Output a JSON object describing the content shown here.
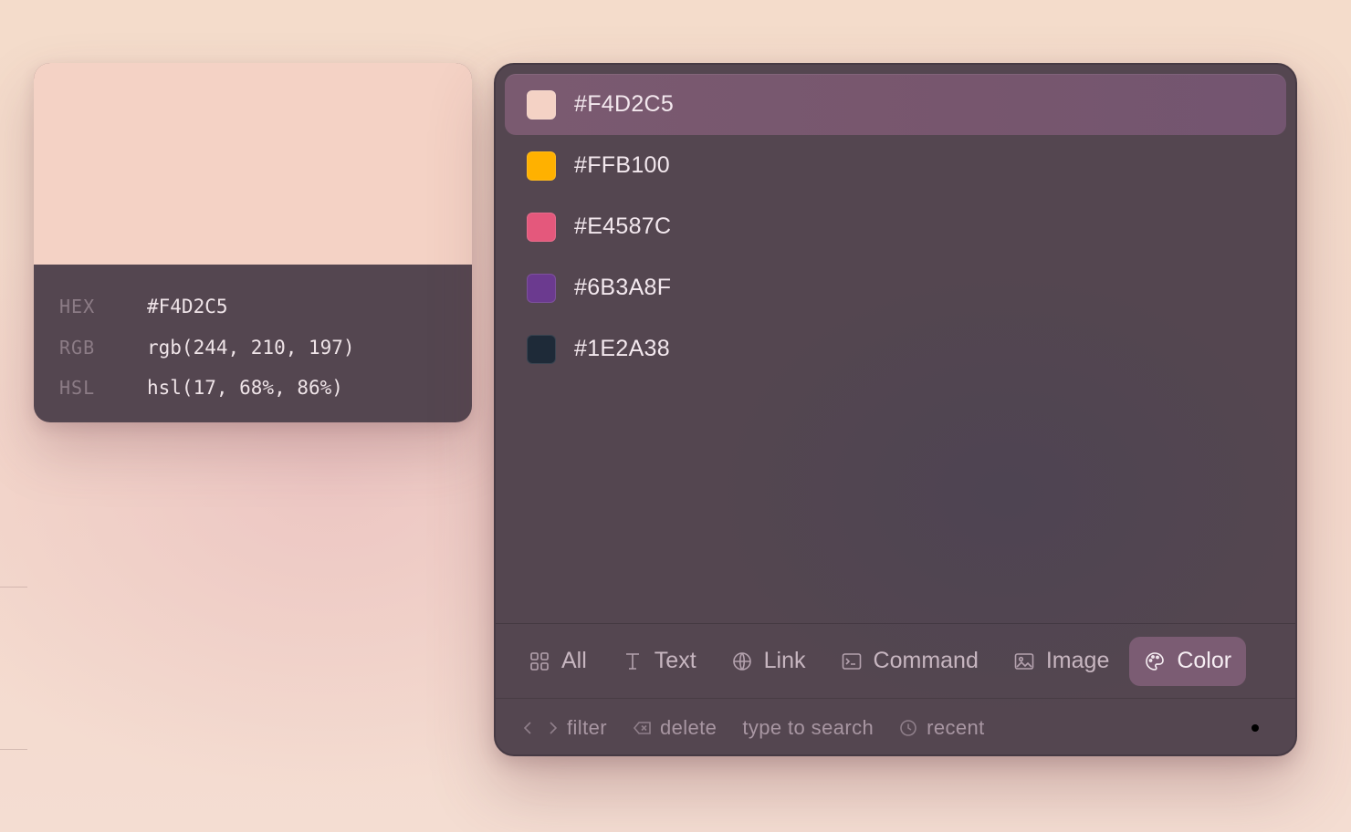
{
  "preview": {
    "swatch_color": "#F4D2C5",
    "rows": [
      {
        "key": "HEX",
        "value": "#F4D2C5"
      },
      {
        "key": "RGB",
        "value": "rgb(244, 210, 197)"
      },
      {
        "key": "HSL",
        "value": "hsl(17, 68%, 86%)"
      }
    ]
  },
  "colors": [
    {
      "label": "#F4D2C5",
      "swatch": "#F4D2C5",
      "selected": true
    },
    {
      "label": "#FFB100",
      "swatch": "#FFB100",
      "selected": false
    },
    {
      "label": "#E4587C",
      "swatch": "#E4587C",
      "selected": false
    },
    {
      "label": "#6B3A8F",
      "swatch": "#6B3A8F",
      "selected": false
    },
    {
      "label": "#1E2A38",
      "swatch": "#1E2A38",
      "selected": false
    }
  ],
  "tabs": [
    {
      "label": "All",
      "icon": "grid-icon",
      "active": false
    },
    {
      "label": "Text",
      "icon": "text-cursor-icon",
      "active": false
    },
    {
      "label": "Link",
      "icon": "globe-icon",
      "active": false
    },
    {
      "label": "Command",
      "icon": "terminal-icon",
      "active": false
    },
    {
      "label": "Image",
      "icon": "image-icon",
      "active": false
    },
    {
      "label": "Color",
      "icon": "palette-icon",
      "active": true
    }
  ],
  "hints": {
    "filter": "filter",
    "delete": "delete",
    "search": "type to search",
    "recent": "recent"
  },
  "theme": {
    "panel_bg": "#544650",
    "selected_bg": "#7A5A70",
    "accent_tab": "#7B5C73"
  }
}
